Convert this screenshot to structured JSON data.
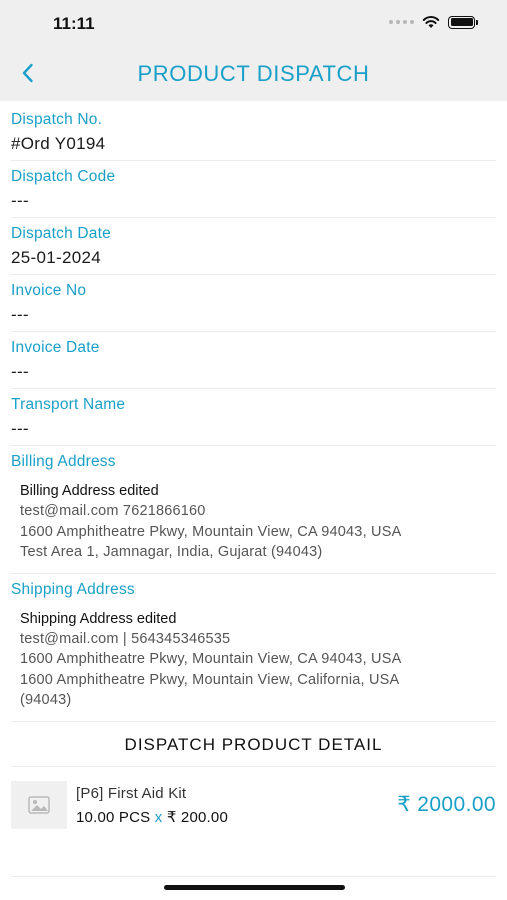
{
  "status_bar": {
    "time": "11:11"
  },
  "nav": {
    "title": "PRODUCT DISPATCH"
  },
  "fields": [
    {
      "label": "Dispatch No.",
      "value": "#Ord Y0194"
    },
    {
      "label": "Dispatch Code",
      "value": "---"
    },
    {
      "label": "Dispatch Date",
      "value": "25-01-2024"
    },
    {
      "label": "Invoice No",
      "value": "---"
    },
    {
      "label": "Invoice Date",
      "value": "---"
    },
    {
      "label": "Transport Name",
      "value": "---"
    }
  ],
  "billing": {
    "label": "Billing Address",
    "name": "Billing Address edited",
    "lines": [
      "test@mail.com 7621866160",
      "1600 Amphitheatre Pkwy, Mountain View, CA 94043, USA",
      "Test Area 1, Jamnagar, India, Gujarat (94043)"
    ]
  },
  "shipping": {
    "label": "Shipping Address",
    "name": "Shipping Address edited",
    "lines": [
      "test@mail.com | 564345346535",
      "1600 Amphitheatre Pkwy, Mountain View, CA 94043, USA",
      "1600 Amphitheatre Pkwy, Mountain View, California, USA",
      "(94043)"
    ]
  },
  "product_section": {
    "title": "DISPATCH PRODUCT DETAIL"
  },
  "products": [
    {
      "name": "[P6] First Aid Kit",
      "qty": "10.00 PCS",
      "times": "x",
      "rate": "₹ 200.00",
      "total": "₹ 2000.00",
      "icon": "image-placeholder-icon"
    }
  ],
  "colors": {
    "accent": "#1aa0c8",
    "header_bg": "#efefef"
  }
}
